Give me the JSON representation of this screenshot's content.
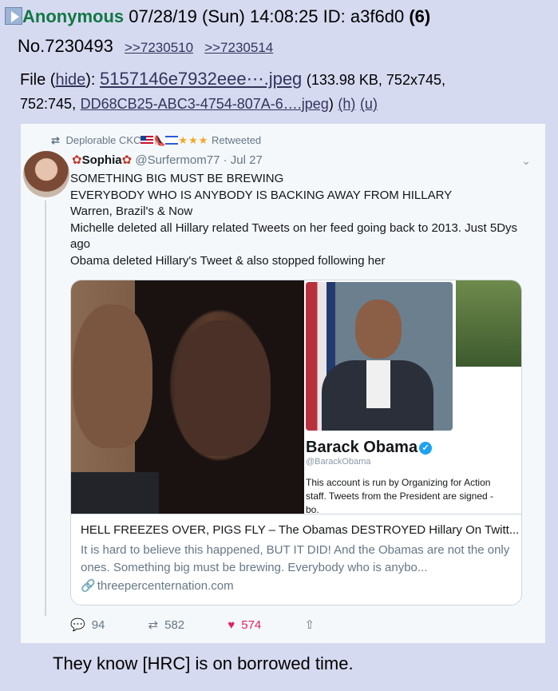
{
  "post": {
    "name": "Anonymous",
    "datetime": "07/28/19 (Sun) 14:08:25",
    "id_label": "ID: a3f6d0",
    "id_count": "(6)",
    "number": "No.7230493",
    "replies": [
      ">>7230510",
      ">>7230514"
    ]
  },
  "file": {
    "label": "File",
    "hide": "hide",
    "filename": "5157146e7932eee⋯.jpeg",
    "meta_open": "(133.98 KB, 752x745,",
    "meta_ratio": "752:745,",
    "original_name": "DD68CB25-ABC3-4754-807A-6….jpeg",
    "meta_close": ")",
    "h_link": "(h)",
    "u_link": "(u)"
  },
  "tweet": {
    "retweeted_by": "Deplorable CKC",
    "retweeted_label": "Retweeted",
    "author_name": "Sophia",
    "author_handle": "@Surfermom77 · Jul 27",
    "lines": [
      "SOMETHING BIG MUST BE BREWING",
      "EVERYBODY WHO IS ANYBODY IS BACKING AWAY FROM HILLARY",
      "Warren, Brazil's & Now",
      "Michelle deleted all Hillary related Tweets on her feed going back to 2013. Just 5Dys ago",
      "Obama deleted Hillary's Tweet & also stopped following her"
    ],
    "card": {
      "profile_name": "Barack Obama",
      "profile_handle": "@BarackObama",
      "profile_bio": "This account is run by Organizing for Action staff. Tweets from the President are signed -bo.",
      "title": "HELL FREEZES OVER, PIGS FLY – The Obamas DESTROYED Hillary On Twitt...",
      "description": "It is hard to believe this happened, BUT IT DID! And the Obamas are not the only ones. Something big must be brewing. Everybody who is anybo...",
      "domain": "threepercenternation.com"
    },
    "actions": {
      "replies": "94",
      "retweets": "582",
      "likes": "574"
    }
  },
  "comment": "They know [HRC] is on borrowed time.",
  "icons": [
    "arrow-icon",
    "retweet-icon",
    "chevron-down-icon",
    "verified-icon",
    "link-icon",
    "reply-icon",
    "heart-icon",
    "share-icon"
  ],
  "colors": {
    "background": "#d6daf0",
    "poster_name": "#117743",
    "link": "#34345c",
    "tweet_bg": "#f5f8fa",
    "like": "#e0245e"
  }
}
